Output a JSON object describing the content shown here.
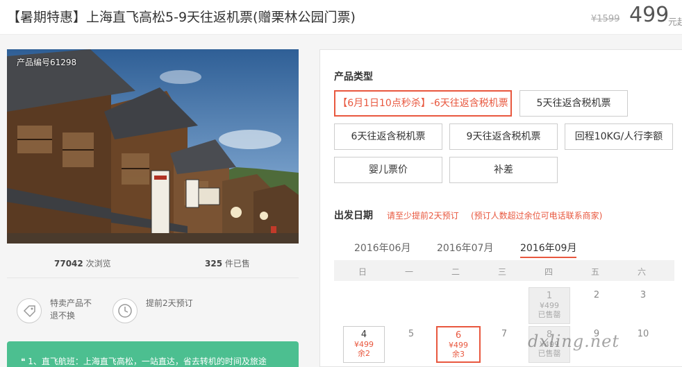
{
  "header": {
    "title": "【暑期特惠】上海直飞高松5-9天往返机票(赠栗林公园门票)",
    "price_original": "¥1599",
    "price_current": "499",
    "price_suffix": "元起"
  },
  "product": {
    "id_label": "产品编号61298",
    "views_count": "77042",
    "views_label": "次浏览",
    "sold_count": "325",
    "sold_label": "件已售"
  },
  "policies": [
    {
      "icon": "tag-icon",
      "text": "特卖产品不退不换"
    },
    {
      "icon": "clock-icon",
      "text": "提前2天预订"
    }
  ],
  "promo": {
    "text": "❝ 1、直飞航班：上海直飞高松，一站直达，省去转机的时间及旅途"
  },
  "product_type": {
    "title": "产品类型",
    "options": [
      {
        "label": "【6月1日10点秒杀】-6天往返含税机票",
        "selected": true
      },
      {
        "label": "5天往返含税机票",
        "selected": false
      },
      {
        "label": "6天往返含税机票",
        "selected": false
      },
      {
        "label": "9天往返含税机票",
        "selected": false
      },
      {
        "label": "回程10KG/人行李额",
        "selected": false
      },
      {
        "label": "婴儿票价",
        "selected": false
      },
      {
        "label": "补差",
        "selected": false
      }
    ]
  },
  "departure": {
    "title": "出发日期",
    "note1": "请至少提前2天预订",
    "note2": "(预订人数超过余位可电话联系商家)",
    "months": [
      "2016年06月",
      "2016年07月",
      "2016年09月"
    ],
    "active_month": 2,
    "weekdays": [
      "日",
      "一",
      "二",
      "三",
      "四",
      "五",
      "六"
    ],
    "days": [
      {
        "day": "1",
        "price": "¥499",
        "status": "已售罄",
        "state": "sold"
      },
      {
        "day": "2",
        "state": "none"
      },
      {
        "day": "3",
        "state": "none"
      },
      {
        "day": "4",
        "price": "¥499",
        "status": "余2",
        "state": "avail"
      },
      {
        "day": "5",
        "state": "none"
      },
      {
        "day": "6",
        "price": "¥499",
        "status": "余3",
        "state": "picked"
      },
      {
        "day": "7",
        "state": "none"
      },
      {
        "day": "8",
        "price": "¥499",
        "status": "已售罄",
        "state": "sold"
      },
      {
        "day": "9",
        "state": "none"
      },
      {
        "day": "10",
        "state": "none"
      }
    ]
  },
  "watermark": "dxling.net",
  "colors": {
    "accent": "#e8573e",
    "promo_bg": "#4cbf90"
  }
}
